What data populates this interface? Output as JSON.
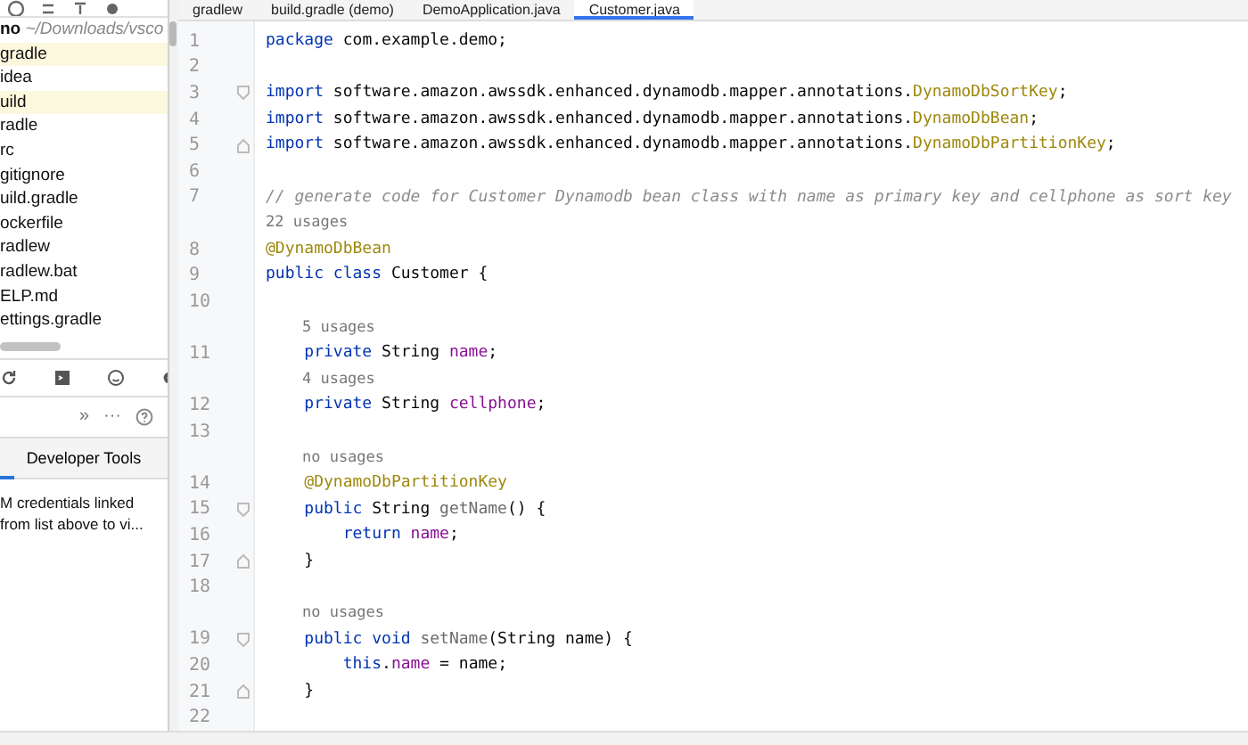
{
  "project_panel": {
    "root": {
      "name": "no",
      "path": "~/Downloads/vsco"
    },
    "items": [
      {
        "name": "gradle",
        "highlighted": true
      },
      {
        "name": "idea",
        "highlighted": false
      },
      {
        "name": "uild",
        "highlighted": true
      },
      {
        "name": "radle",
        "highlighted": false
      },
      {
        "name": "rc",
        "highlighted": false
      },
      {
        "name": "gitignore",
        "highlighted": false
      },
      {
        "name": "uild.gradle",
        "highlighted": false
      },
      {
        "name": "ockerfile",
        "highlighted": false
      },
      {
        "name": "radlew",
        "highlighted": false
      },
      {
        "name": "radlew.bat",
        "highlighted": false
      },
      {
        "name": "ELP.md",
        "highlighted": false
      },
      {
        "name": "ettings.gradle",
        "highlighted": false
      }
    ]
  },
  "tool_panel": {
    "overflow": "»",
    "more": "···",
    "tab": {
      "label": "Developer Tools",
      "selected": true
    },
    "message": [
      "M credentials linked",
      "from list above to vi..."
    ]
  },
  "editor_tabs": [
    {
      "label": "gradlew",
      "selected": false
    },
    {
      "label": "build.gradle (demo)",
      "selected": false
    },
    {
      "label": "DemoApplication.java",
      "selected": false
    },
    {
      "label": "Customer.java",
      "selected": true
    }
  ],
  "lines": [
    {
      "kind": "code",
      "number": "1",
      "tokens": [
        {
          "kind": "keyword",
          "text": "package"
        },
        {
          "kind": "plain",
          "text": " com.example.demo;"
        }
      ]
    },
    {
      "kind": "code",
      "number": "2"
    },
    {
      "kind": "fold_start",
      "number": "3",
      "tokens": [
        {
          "kind": "keyword",
          "text": "import"
        },
        {
          "kind": "plain",
          "text": " software.amazon.awssdk.enhanced.dynamodb.mapper.annotations."
        },
        {
          "kind": "annotation",
          "text": "DynamoDbSortKey"
        },
        {
          "kind": "plain",
          "text": ";"
        }
      ]
    },
    {
      "kind": "code",
      "number": "4",
      "tokens": [
        {
          "kind": "keyword",
          "text": "import"
        },
        {
          "kind": "plain",
          "text": " software.amazon.awssdk.enhanced.dynamodb.mapper.annotations."
        },
        {
          "kind": "annotation",
          "text": "DynamoDbBean"
        },
        {
          "kind": "plain",
          "text": ";"
        }
      ]
    },
    {
      "kind": "fold_end",
      "number": "5",
      "tokens": [
        {
          "kind": "keyword",
          "text": "import"
        },
        {
          "kind": "plain",
          "text": " software.amazon.awssdk.enhanced.dynamodb.mapper.annotations."
        },
        {
          "kind": "annotation",
          "text": "DynamoDbPartitionKey"
        },
        {
          "kind": "plain",
          "text": ";"
        }
      ]
    },
    {
      "kind": "code",
      "number": "6"
    },
    {
      "kind": "code",
      "number": "7",
      "tokens": [
        {
          "kind": "comment",
          "text": "// generate code for Customer Dynamodb bean class with name as primary key and cellphone as sort key"
        }
      ]
    },
    {
      "kind": "hint",
      "text": "22 usages"
    },
    {
      "kind": "code",
      "number": "8",
      "tokens": [
        {
          "kind": "annotation",
          "text": "@DynamoDbBean"
        }
      ]
    },
    {
      "kind": "code",
      "number": "9",
      "tokens": [
        {
          "kind": "keyword",
          "text": "public class"
        },
        {
          "kind": "plain",
          "text": " Customer {"
        }
      ]
    },
    {
      "kind": "code",
      "number": "10"
    },
    {
      "kind": "hint",
      "text": "    5 usages"
    },
    {
      "kind": "code",
      "number": "11",
      "tokens": [
        {
          "kind": "keyword",
          "text": "    private"
        },
        {
          "kind": "plain",
          "text": " String "
        },
        {
          "kind": "field",
          "text": "name"
        },
        {
          "kind": "plain",
          "text": ";"
        }
      ]
    },
    {
      "kind": "hint",
      "text": "    4 usages"
    },
    {
      "kind": "code",
      "number": "12",
      "tokens": [
        {
          "kind": "keyword",
          "text": "    private"
        },
        {
          "kind": "plain",
          "text": " String "
        },
        {
          "kind": "field",
          "text": "cellphone"
        },
        {
          "kind": "plain",
          "text": ";"
        }
      ]
    },
    {
      "kind": "code",
      "number": "13"
    },
    {
      "kind": "hint",
      "text": "    no usages"
    },
    {
      "kind": "code",
      "number": "14",
      "tokens": [
        {
          "kind": "annotation",
          "text": "    @DynamoDbPartitionKey"
        }
      ]
    },
    {
      "kind": "fold_start",
      "number": "15",
      "tokens": [
        {
          "kind": "keyword",
          "text": "    public"
        },
        {
          "kind": "plain",
          "text": " String "
        },
        {
          "kind": "method",
          "text": "getName"
        },
        {
          "kind": "plain",
          "text": "() {"
        }
      ]
    },
    {
      "kind": "code",
      "number": "16",
      "tokens": [
        {
          "kind": "keyword",
          "text": "        return "
        },
        {
          "kind": "field",
          "text": "name"
        },
        {
          "kind": "plain",
          "text": ";"
        }
      ]
    },
    {
      "kind": "fold_end",
      "number": "17",
      "tokens": [
        {
          "kind": "plain",
          "text": "    }"
        }
      ]
    },
    {
      "kind": "code",
      "number": "18"
    },
    {
      "kind": "hint",
      "text": "    no usages"
    },
    {
      "kind": "fold_start",
      "number": "19",
      "tokens": [
        {
          "kind": "keyword",
          "text": "    public void "
        },
        {
          "kind": "method",
          "text": "setName"
        },
        {
          "kind": "plain",
          "text": "(String name) {"
        }
      ]
    },
    {
      "kind": "code",
      "number": "20",
      "tokens": [
        {
          "kind": "keyword",
          "text": "        this"
        },
        {
          "kind": "plain",
          "text": "."
        },
        {
          "kind": "field",
          "text": "name"
        },
        {
          "kind": "plain",
          "text": " = name;"
        }
      ]
    },
    {
      "kind": "fold_end",
      "number": "21",
      "tokens": [
        {
          "kind": "plain",
          "text": "    }"
        }
      ]
    },
    {
      "kind": "code",
      "number": "22"
    }
  ]
}
